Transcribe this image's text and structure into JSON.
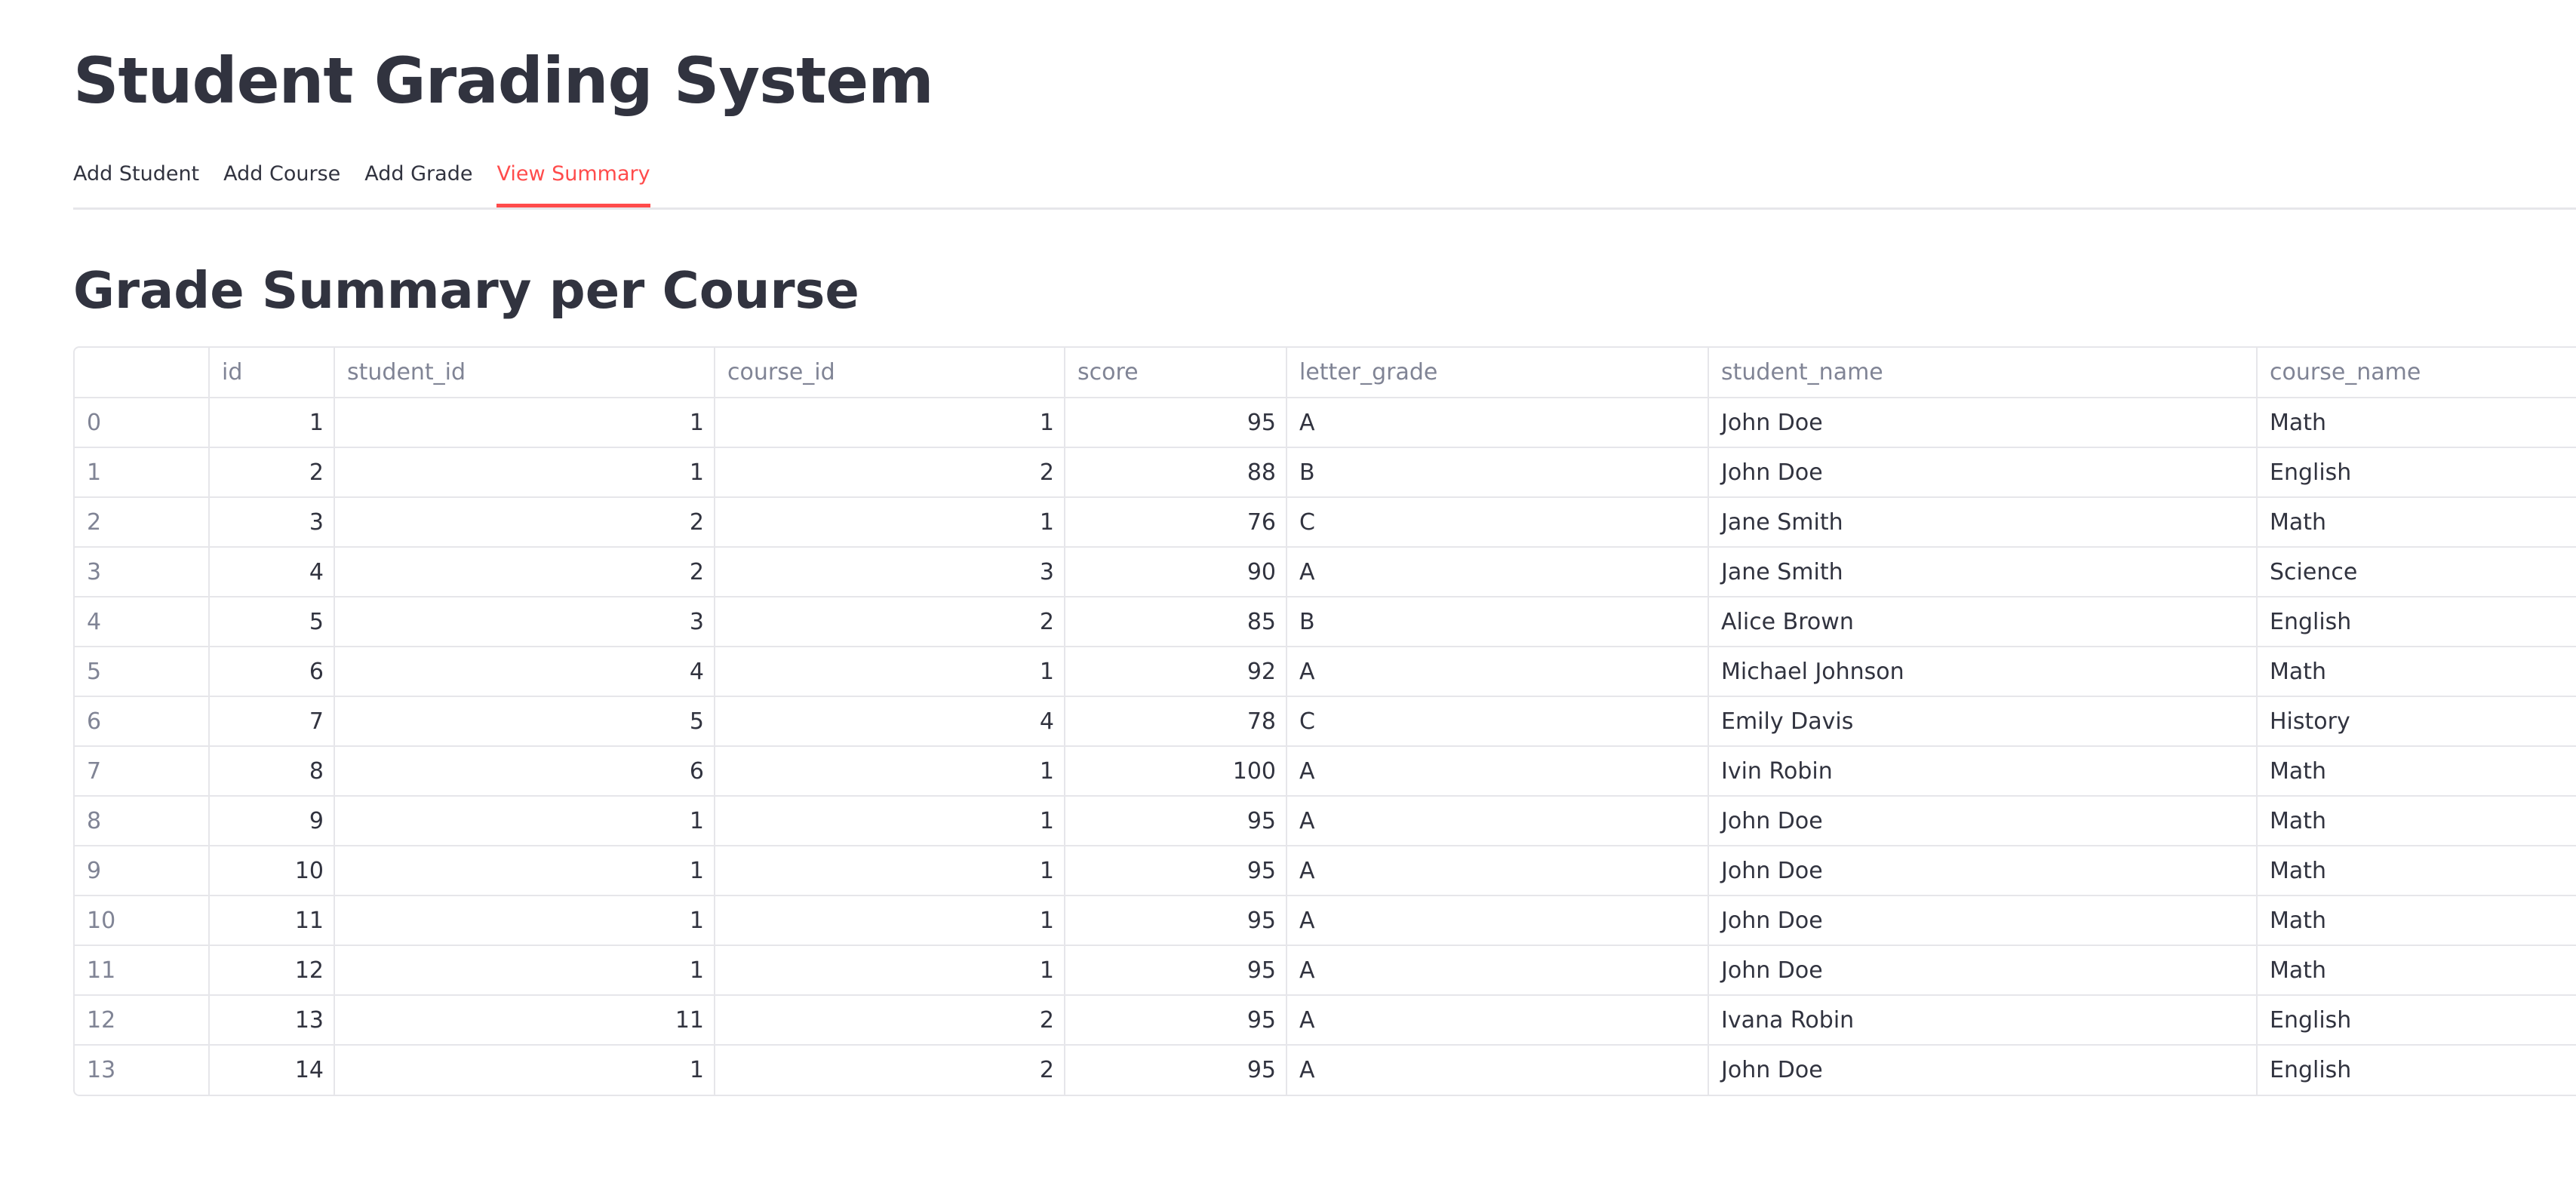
{
  "app": {
    "title": "Student Grading System"
  },
  "tabs": [
    {
      "label": "Add Student",
      "active": false
    },
    {
      "label": "Add Course",
      "active": false
    },
    {
      "label": "Add Grade",
      "active": false
    },
    {
      "label": "View Summary",
      "active": true
    }
  ],
  "colors": {
    "accent": "#ff4b4b",
    "text": "#31333f",
    "muted": "#808495",
    "border": "#e6e6ea"
  },
  "summary": {
    "title": "Grade Summary per Course",
    "columns": [
      "",
      "id",
      "student_id",
      "course_id",
      "score",
      "letter_grade",
      "student_name",
      "course_name"
    ],
    "rows": [
      [
        "0",
        "1",
        "1",
        "1",
        "95",
        "A",
        "John Doe",
        "Math"
      ],
      [
        "1",
        "2",
        "1",
        "2",
        "88",
        "B",
        "John Doe",
        "English"
      ],
      [
        "2",
        "3",
        "2",
        "1",
        "76",
        "C",
        "Jane Smith",
        "Math"
      ],
      [
        "3",
        "4",
        "2",
        "3",
        "90",
        "A",
        "Jane Smith",
        "Science"
      ],
      [
        "4",
        "5",
        "3",
        "2",
        "85",
        "B",
        "Alice Brown",
        "English"
      ],
      [
        "5",
        "6",
        "4",
        "1",
        "92",
        "A",
        "Michael Johnson",
        "Math"
      ],
      [
        "6",
        "7",
        "5",
        "4",
        "78",
        "C",
        "Emily Davis",
        "History"
      ],
      [
        "7",
        "8",
        "6",
        "1",
        "100",
        "A",
        "Ivin Robin",
        "Math"
      ],
      [
        "8",
        "9",
        "1",
        "1",
        "95",
        "A",
        "John Doe",
        "Math"
      ],
      [
        "9",
        "10",
        "1",
        "1",
        "95",
        "A",
        "John Doe",
        "Math"
      ],
      [
        "10",
        "11",
        "1",
        "1",
        "95",
        "A",
        "John Doe",
        "Math"
      ],
      [
        "11",
        "12",
        "1",
        "1",
        "95",
        "A",
        "John Doe",
        "Math"
      ],
      [
        "12",
        "13",
        "11",
        "2",
        "95",
        "A",
        "Ivana Robin",
        "English"
      ],
      [
        "13",
        "14",
        "1",
        "2",
        "95",
        "A",
        "John Doe",
        "English"
      ]
    ]
  }
}
